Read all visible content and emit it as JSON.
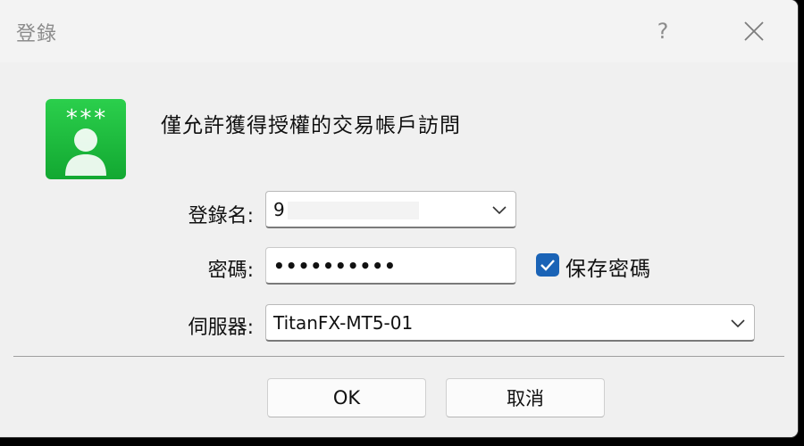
{
  "window": {
    "title": "登錄",
    "help_label": "?",
    "close_icon": "close-icon"
  },
  "message": "僅允許獲得授權的交易帳戶訪問",
  "icon": {
    "name": "login-user-icon",
    "stars": "***",
    "color": "#1fbf3e"
  },
  "fields": {
    "login_label": "登錄名:",
    "login_value": "9",
    "password_label": "密碼:",
    "password_value": "••••••••••",
    "save_password_label": "保存密碼",
    "save_password_checked": true,
    "server_label": "伺服器:",
    "server_value": "TitanFX-MT5-01"
  },
  "buttons": {
    "ok": "OK",
    "cancel": "取消"
  },
  "colors": {
    "accent": "#1a63b6",
    "icon_green": "#1fbf3e",
    "dialog_bg": "#f0f0f0"
  }
}
